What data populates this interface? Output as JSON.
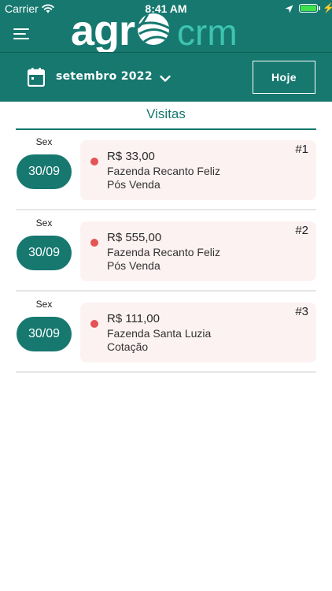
{
  "status_bar": {
    "carrier": "Carrier",
    "time": "8:41 AM",
    "battery_level": 1.0,
    "battery_color": "#3fe24c"
  },
  "header": {
    "logo_left": "agr",
    "logo_right": "crm",
    "menu_icon": "hamburger-menu-icon",
    "background": "#16786f"
  },
  "date_selector": {
    "month_label": "setembro 2022",
    "calendar_icon": "calendar-icon",
    "dropdown_icon": "chevron-down-icon",
    "today_button": "Hoje"
  },
  "section": {
    "title": "Visitas"
  },
  "visits": [
    {
      "weekday": "Sex",
      "date": "30/09",
      "value": "R$ 33,00",
      "farm": "Fazenda Recanto Feliz",
      "type": "Pós Venda",
      "number": "#1",
      "status_color": "#e45454"
    },
    {
      "weekday": "Sex",
      "date": "30/09",
      "value": "R$ 555,00",
      "farm": "Fazenda Recanto Feliz",
      "type": "Pós Venda",
      "number": "#2",
      "status_color": "#e45454"
    },
    {
      "weekday": "Sex",
      "date": "30/09",
      "value": "R$ 111,00",
      "farm": "Fazenda Santa Luzia",
      "type": "Cotação",
      "number": "#3",
      "status_color": "#e45454"
    }
  ]
}
